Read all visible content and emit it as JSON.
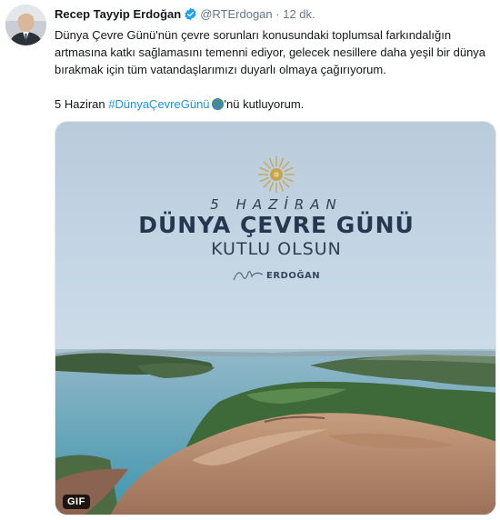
{
  "tweet": {
    "author_name": "Recep Tayyip Erdoğan",
    "handle": "@RTErdogan",
    "separator": "·",
    "timestamp": "12 dk.",
    "verified_color": "#1da1f2",
    "paragraph1": "Dünya Çevre Günü'nün çevre sorunları konusundaki toplumsal farkındalığın artmasına katkı sağlamasını temenni ediyor, gelecek nesillere daha yeşil bir dünya bırakmak için tüm vatandaşlarımızı duyarlı olmaya çağırıyorum.",
    "paragraph2_prefix": "5 Haziran ",
    "hashtag": "#DünyaÇevreGünü",
    "paragraph2_suffix": "'nü kutluyorum.",
    "hashtag_color": "#1b95e0"
  },
  "media": {
    "date_text": "5 HAZİRAN",
    "title": "DÜNYA ÇEVRE GÜNÜ",
    "subtitle": "KUTLU OLSUN",
    "signature": "ERDOĞAN",
    "badge": "GIF"
  }
}
